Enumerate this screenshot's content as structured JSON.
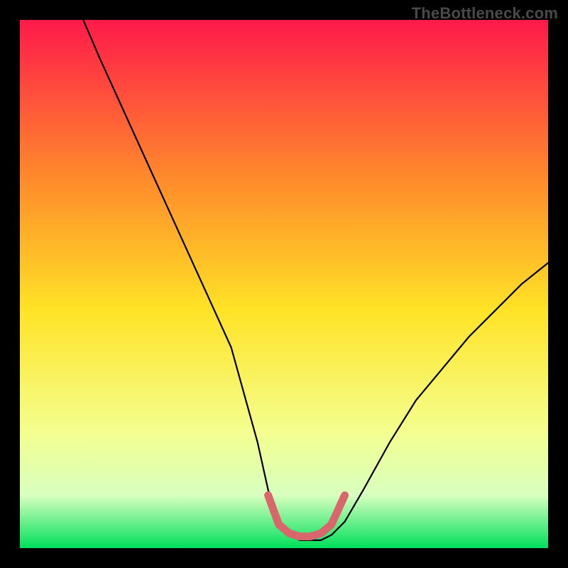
{
  "watermark": "TheBottleneck.com",
  "colors": {
    "page_bg": "#000000",
    "gradient_top": "#ff1a4a",
    "gradient_upper_mid": "#ff8a2b",
    "gradient_mid": "#ffe326",
    "gradient_lower_mid": "#f4ff8f",
    "gradient_bottom": "#00e05c",
    "curve_stroke": "#000000",
    "optimal_marker": "#d9666a"
  },
  "chart_data": {
    "type": "line",
    "title": "",
    "xlabel": "",
    "ylabel": "",
    "xlim": [
      0,
      100
    ],
    "ylim": [
      0,
      100
    ],
    "series": [
      {
        "name": "bottleneck-curve",
        "x": [
          12,
          15,
          20,
          25,
          30,
          35,
          40,
          45,
          47,
          49,
          51,
          53,
          55,
          57,
          59,
          61.5,
          65,
          70,
          75,
          80,
          85,
          90,
          95,
          100
        ],
        "y": [
          100,
          93,
          82,
          71,
          60,
          49,
          38,
          20,
          11,
          5,
          2.5,
          1.5,
          1.5,
          1.5,
          2.5,
          5,
          11,
          20,
          28,
          34,
          40,
          45,
          50,
          54
        ]
      }
    ],
    "optimal_marker": {
      "name": "optimal-range",
      "x": [
        47,
        49,
        51,
        53,
        55,
        57,
        59,
        61.5
      ],
      "y": [
        10,
        4.5,
        2.8,
        2.2,
        2.2,
        2.8,
        4.5,
        10
      ]
    },
    "gradient_stops_pct": [
      0,
      30,
      55,
      78,
      90,
      100
    ]
  }
}
